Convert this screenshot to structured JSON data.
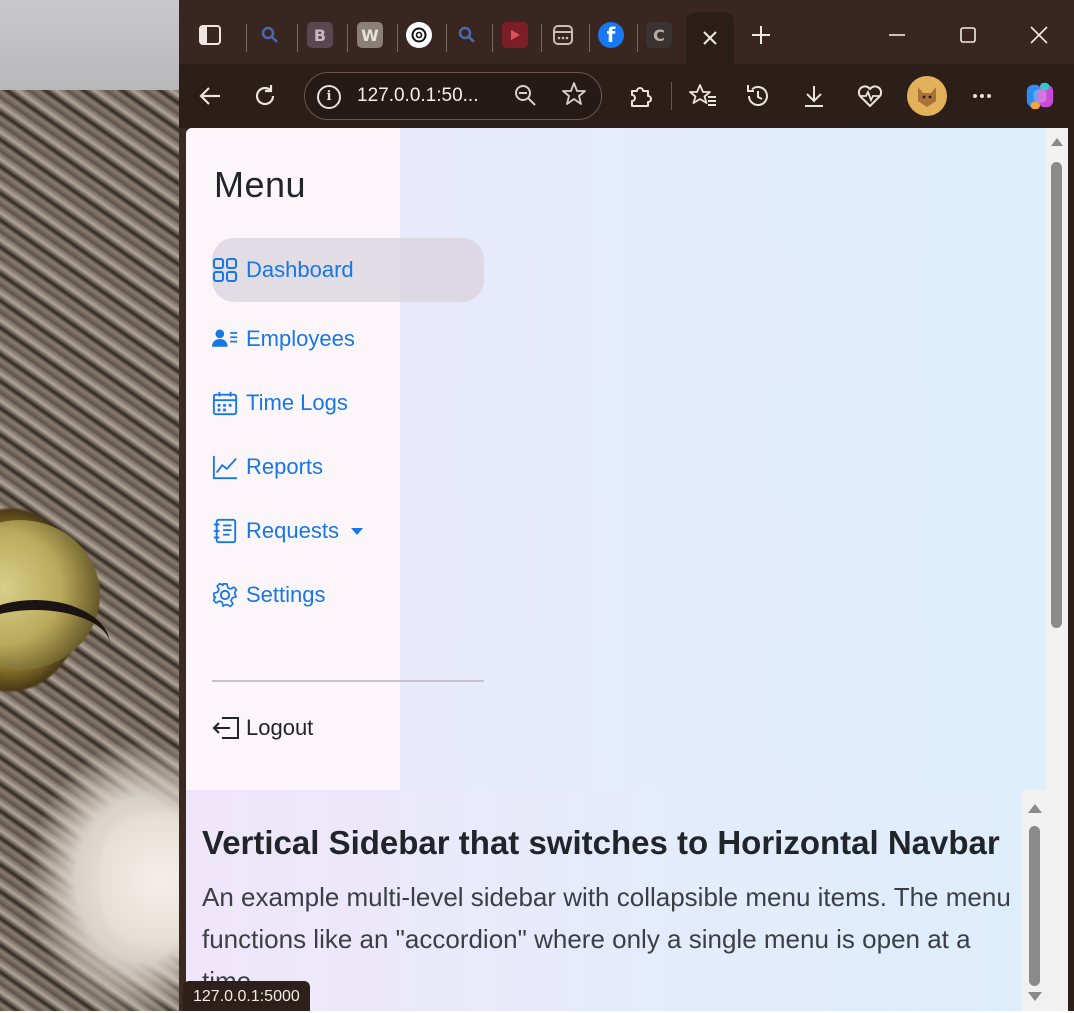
{
  "browser": {
    "address_url": "127.0.0.1:50...",
    "status_url": "127.0.0.1:5000",
    "tabs": [
      {
        "icon": "sidebar-icon"
      },
      {
        "icon": "search-icon"
      },
      {
        "icon": "bootstrap-icon",
        "glyph": "B"
      },
      {
        "icon": "w-icon",
        "glyph": "W"
      },
      {
        "icon": "openai-icon"
      },
      {
        "icon": "search-icon"
      },
      {
        "icon": "youtube-icon"
      },
      {
        "icon": "app-icon"
      },
      {
        "icon": "facebook-icon",
        "glyph": "f"
      },
      {
        "icon": "c-icon",
        "glyph": "C"
      }
    ],
    "colors": {
      "titlebar": "#3a2620",
      "toolbar": "#2c1f1a",
      "link": "#1677e6"
    }
  },
  "sidebar": {
    "title": "Menu",
    "items": [
      {
        "label": "Dashboard",
        "icon": "grid-icon",
        "active": true
      },
      {
        "label": "Employees",
        "icon": "people-list-icon"
      },
      {
        "label": "Time Logs",
        "icon": "calendar-icon"
      },
      {
        "label": "Reports",
        "icon": "chart-line-icon"
      },
      {
        "label": "Requests",
        "icon": "notebook-icon",
        "dropdown": true
      },
      {
        "label": "Settings",
        "icon": "gear-icon"
      }
    ],
    "logout": {
      "label": "Logout",
      "icon": "logout-icon"
    }
  },
  "content": {
    "heading": "Vertical Sidebar that switches to Horizontal Navbar",
    "description": "An example multi-level sidebar with collapsible menu items. The menu functions like an \"accordion\" where only a single menu is open at a time."
  }
}
